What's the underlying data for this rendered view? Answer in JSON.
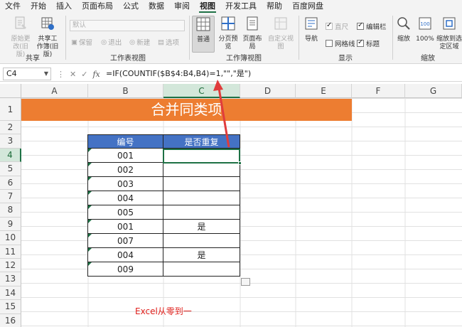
{
  "menu": {
    "tabs": [
      "文件",
      "开始",
      "插入",
      "页面布局",
      "公式",
      "数据",
      "审阅",
      "视图",
      "开发工具",
      "帮助",
      "百度网盘"
    ],
    "active": "视图"
  },
  "ribbon": {
    "share": {
      "title": "共享",
      "btn_restore": "原始更改(旧版)",
      "btn_share": "共享工作簿(旧版)"
    },
    "sheetview": {
      "title": "工作表视图",
      "combo": "默认",
      "keep": "保留",
      "exit": "退出",
      "new": "新建",
      "options": "选项"
    },
    "workbookview": {
      "title": "工作簿视图",
      "normal": "普通",
      "pagebreak": "分页预览",
      "pagelayout": "页面布局",
      "custom": "自定义视图"
    },
    "show": {
      "title": "显示",
      "nav": "导航",
      "ruler": "直尺",
      "gridlines": "网格线",
      "formulabar": "编辑栏",
      "headings": "标题"
    },
    "zoom": {
      "title": "缩放",
      "zoom": "缩放",
      "hundred": "100%",
      "selection": "缩放到选定区域"
    }
  },
  "formula_bar": {
    "name_box": "C4",
    "cancel": "✕",
    "enter": "✓",
    "fx": "fx",
    "formula": "=IF(COUNTIF($B$4:B4,B4)=1,\"\",\"是\")"
  },
  "grid": {
    "columns": [
      "A",
      "B",
      "C",
      "D",
      "E",
      "F",
      "G"
    ],
    "rows": [
      "1",
      "2",
      "3",
      "4",
      "5",
      "6",
      "7",
      "8",
      "9",
      "10",
      "11",
      "12",
      "13",
      "14",
      "15",
      "16"
    ]
  },
  "sheet": {
    "banner": "合并同类项",
    "table_headers": [
      "编号",
      "是否重复"
    ],
    "table_rows": [
      [
        "001",
        ""
      ],
      [
        "002",
        ""
      ],
      [
        "003",
        ""
      ],
      [
        "004",
        ""
      ],
      [
        "005",
        ""
      ],
      [
        "001",
        "是"
      ],
      [
        "007",
        ""
      ],
      [
        "004",
        "是"
      ],
      [
        "009",
        ""
      ]
    ],
    "footer": "Excel从零到一"
  },
  "colors": {
    "banner": "#ed7d31",
    "header": "#4472c4",
    "accent": "#1e7145",
    "arrow": "#e03c3c"
  }
}
